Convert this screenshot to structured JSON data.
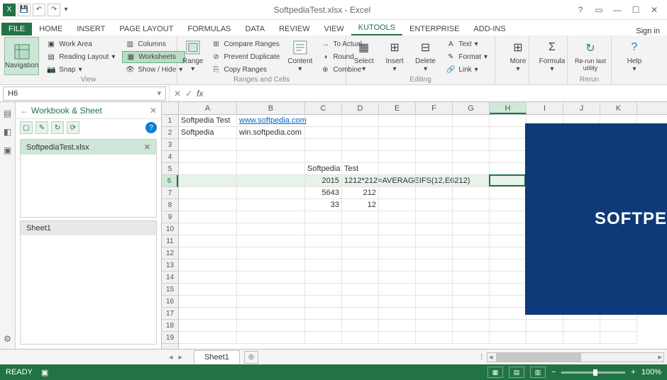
{
  "title": "SoftpediaTest.xlsx - Excel",
  "file_tab": "FILE",
  "tabs": [
    "HOME",
    "INSERT",
    "PAGE LAYOUT",
    "FORMULAS",
    "DATA",
    "REVIEW",
    "VIEW",
    "KUTOOLS",
    "ENTERPRISE",
    "ADD-INS"
  ],
  "active_tab": 7,
  "sign_in": "Sign in",
  "ribbon": {
    "navigation": "Navigation",
    "work_area": "Work Area",
    "reading_layout": "Reading Layout",
    "snap": "Snap",
    "columns": "Columns",
    "worksheets": "Worksheets",
    "show_hide": "Show / Hide",
    "view_label": "View",
    "range": "Range",
    "compare_ranges": "Compare Ranges",
    "prevent_duplicate": "Prevent Duplicate",
    "copy_ranges": "Copy Ranges",
    "content": "Content",
    "to_actual": "To Actual",
    "round": "Round",
    "combine": "Combine",
    "ranges_cells_label": "Ranges and Cells",
    "select": "Select",
    "insert": "Insert",
    "delete": "Delete",
    "text": "Text",
    "format": "Format",
    "link": "Link",
    "editing_label": "Editing",
    "more": "More",
    "formula": "Formula",
    "rerun": "Re-run last utility",
    "rerun_label": "Rerun",
    "help": "Help"
  },
  "name_box": "H6",
  "fx": "fx",
  "panel": {
    "title": "Workbook & Sheet",
    "workbook": "SoftpediaTest.xlsx",
    "sheet": "Sheet1"
  },
  "columns": [
    "A",
    "B",
    "C",
    "D",
    "E",
    "F",
    "G",
    "H",
    "I",
    "J",
    "K"
  ],
  "rows": 19,
  "selected_cell": {
    "row": 6,
    "col": "H"
  },
  "cells": {
    "A1": "Softpedia Test",
    "B1": "www.softpedia.com",
    "A2": "Softpedia",
    "B2": "win.softpedia.com",
    "C5": "Softpedia",
    "D5": "Test",
    "C6": "2015",
    "D6": "1212*212=AVERAGEIFS(12,E6212)",
    "C7": "5643",
    "D7": "212",
    "C8": "33",
    "D8": "12"
  },
  "sheet_tab": "Sheet1",
  "status": {
    "ready": "READY",
    "zoom": "100%"
  },
  "overlay_text": "SOFTPE"
}
